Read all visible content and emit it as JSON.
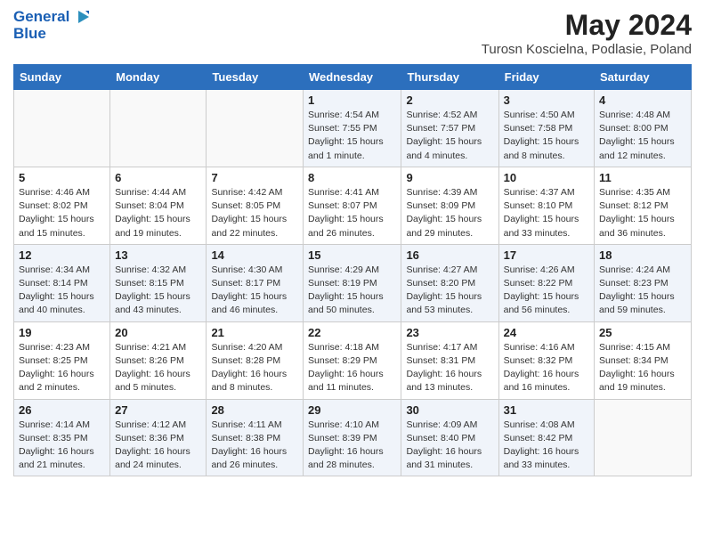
{
  "header": {
    "logo_line1": "General",
    "logo_line2": "Blue",
    "month": "May 2024",
    "location": "Turosn Koscielna, Podlasie, Poland"
  },
  "columns": [
    "Sunday",
    "Monday",
    "Tuesday",
    "Wednesday",
    "Thursday",
    "Friday",
    "Saturday"
  ],
  "weeks": [
    [
      {
        "day": "",
        "info": ""
      },
      {
        "day": "",
        "info": ""
      },
      {
        "day": "",
        "info": ""
      },
      {
        "day": "1",
        "info": "Sunrise: 4:54 AM\nSunset: 7:55 PM\nDaylight: 15 hours\nand 1 minute."
      },
      {
        "day": "2",
        "info": "Sunrise: 4:52 AM\nSunset: 7:57 PM\nDaylight: 15 hours\nand 4 minutes."
      },
      {
        "day": "3",
        "info": "Sunrise: 4:50 AM\nSunset: 7:58 PM\nDaylight: 15 hours\nand 8 minutes."
      },
      {
        "day": "4",
        "info": "Sunrise: 4:48 AM\nSunset: 8:00 PM\nDaylight: 15 hours\nand 12 minutes."
      }
    ],
    [
      {
        "day": "5",
        "info": "Sunrise: 4:46 AM\nSunset: 8:02 PM\nDaylight: 15 hours\nand 15 minutes."
      },
      {
        "day": "6",
        "info": "Sunrise: 4:44 AM\nSunset: 8:04 PM\nDaylight: 15 hours\nand 19 minutes."
      },
      {
        "day": "7",
        "info": "Sunrise: 4:42 AM\nSunset: 8:05 PM\nDaylight: 15 hours\nand 22 minutes."
      },
      {
        "day": "8",
        "info": "Sunrise: 4:41 AM\nSunset: 8:07 PM\nDaylight: 15 hours\nand 26 minutes."
      },
      {
        "day": "9",
        "info": "Sunrise: 4:39 AM\nSunset: 8:09 PM\nDaylight: 15 hours\nand 29 minutes."
      },
      {
        "day": "10",
        "info": "Sunrise: 4:37 AM\nSunset: 8:10 PM\nDaylight: 15 hours\nand 33 minutes."
      },
      {
        "day": "11",
        "info": "Sunrise: 4:35 AM\nSunset: 8:12 PM\nDaylight: 15 hours\nand 36 minutes."
      }
    ],
    [
      {
        "day": "12",
        "info": "Sunrise: 4:34 AM\nSunset: 8:14 PM\nDaylight: 15 hours\nand 40 minutes."
      },
      {
        "day": "13",
        "info": "Sunrise: 4:32 AM\nSunset: 8:15 PM\nDaylight: 15 hours\nand 43 minutes."
      },
      {
        "day": "14",
        "info": "Sunrise: 4:30 AM\nSunset: 8:17 PM\nDaylight: 15 hours\nand 46 minutes."
      },
      {
        "day": "15",
        "info": "Sunrise: 4:29 AM\nSunset: 8:19 PM\nDaylight: 15 hours\nand 50 minutes."
      },
      {
        "day": "16",
        "info": "Sunrise: 4:27 AM\nSunset: 8:20 PM\nDaylight: 15 hours\nand 53 minutes."
      },
      {
        "day": "17",
        "info": "Sunrise: 4:26 AM\nSunset: 8:22 PM\nDaylight: 15 hours\nand 56 minutes."
      },
      {
        "day": "18",
        "info": "Sunrise: 4:24 AM\nSunset: 8:23 PM\nDaylight: 15 hours\nand 59 minutes."
      }
    ],
    [
      {
        "day": "19",
        "info": "Sunrise: 4:23 AM\nSunset: 8:25 PM\nDaylight: 16 hours\nand 2 minutes."
      },
      {
        "day": "20",
        "info": "Sunrise: 4:21 AM\nSunset: 8:26 PM\nDaylight: 16 hours\nand 5 minutes."
      },
      {
        "day": "21",
        "info": "Sunrise: 4:20 AM\nSunset: 8:28 PM\nDaylight: 16 hours\nand 8 minutes."
      },
      {
        "day": "22",
        "info": "Sunrise: 4:18 AM\nSunset: 8:29 PM\nDaylight: 16 hours\nand 11 minutes."
      },
      {
        "day": "23",
        "info": "Sunrise: 4:17 AM\nSunset: 8:31 PM\nDaylight: 16 hours\nand 13 minutes."
      },
      {
        "day": "24",
        "info": "Sunrise: 4:16 AM\nSunset: 8:32 PM\nDaylight: 16 hours\nand 16 minutes."
      },
      {
        "day": "25",
        "info": "Sunrise: 4:15 AM\nSunset: 8:34 PM\nDaylight: 16 hours\nand 19 minutes."
      }
    ],
    [
      {
        "day": "26",
        "info": "Sunrise: 4:14 AM\nSunset: 8:35 PM\nDaylight: 16 hours\nand 21 minutes."
      },
      {
        "day": "27",
        "info": "Sunrise: 4:12 AM\nSunset: 8:36 PM\nDaylight: 16 hours\nand 24 minutes."
      },
      {
        "day": "28",
        "info": "Sunrise: 4:11 AM\nSunset: 8:38 PM\nDaylight: 16 hours\nand 26 minutes."
      },
      {
        "day": "29",
        "info": "Sunrise: 4:10 AM\nSunset: 8:39 PM\nDaylight: 16 hours\nand 28 minutes."
      },
      {
        "day": "30",
        "info": "Sunrise: 4:09 AM\nSunset: 8:40 PM\nDaylight: 16 hours\nand 31 minutes."
      },
      {
        "day": "31",
        "info": "Sunrise: 4:08 AM\nSunset: 8:42 PM\nDaylight: 16 hours\nand 33 minutes."
      },
      {
        "day": "",
        "info": ""
      }
    ]
  ]
}
